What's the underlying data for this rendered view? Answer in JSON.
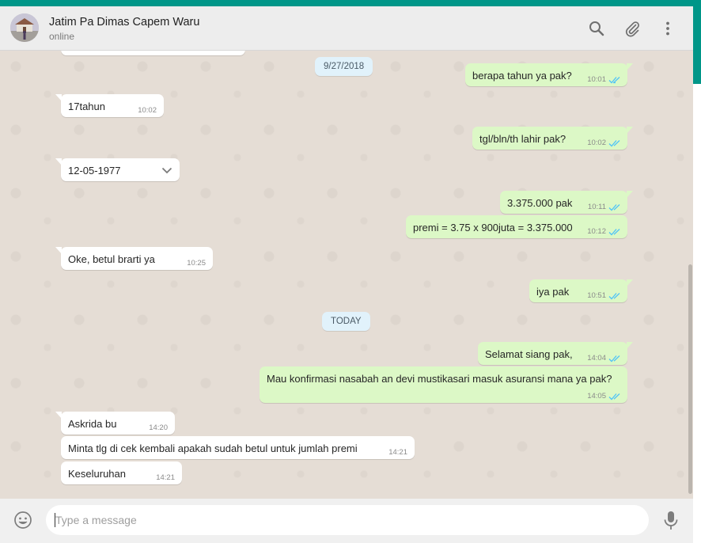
{
  "header": {
    "contact_name": "Jatim Pa Dimas Capem Waru",
    "status": "online",
    "icons": [
      "search-icon",
      "paperclip-icon",
      "menu-dots-icon"
    ]
  },
  "dates": {
    "first": "9/27/2018",
    "today": "TODAY"
  },
  "messages": [
    {
      "dir": "out",
      "text": "berapa tahun ya pak?",
      "time": "10:01"
    },
    {
      "dir": "in",
      "text": "17tahun",
      "time": "10:02"
    },
    {
      "dir": "out",
      "text": "tgl/bln/th lahir pak?",
      "time": "10:02"
    },
    {
      "dir": "in",
      "text": "12-05-1977",
      "time": ""
    },
    {
      "dir": "out",
      "text": "3.375.000 pak",
      "time": "10:11"
    },
    {
      "dir": "out",
      "text": "premi = 3.75 x 900juta = 3.375.000",
      "time": "10:12"
    },
    {
      "dir": "in",
      "text": "Oke, betul brarti ya",
      "time": "10:25"
    },
    {
      "dir": "out",
      "text": "iya pak",
      "time": "10:51"
    },
    {
      "dir": "out",
      "text": "Selamat siang pak,",
      "time": "14:04"
    },
    {
      "dir": "out",
      "text": "Mau konfirmasi nasabah an devi mustikasari masuk asuransi mana ya pak?",
      "time": "14:05"
    },
    {
      "dir": "in",
      "text": "Askrida bu",
      "time": "14:20"
    },
    {
      "dir": "in",
      "text": "Minta tlg di cek kembali apakah sudah betul untuk jumlah premi",
      "time": "14:21"
    },
    {
      "dir": "in",
      "text": "Keseluruhan",
      "time": "14:21"
    }
  ],
  "composer": {
    "placeholder": "Type a message",
    "icons": [
      "emoji-icon",
      "microphone-icon"
    ]
  },
  "colors": {
    "accent": "#009688",
    "outgoing_bubble": "#dcf8c6",
    "incoming_bubble": "#ffffff",
    "chat_background": "#e5ddd5",
    "read_ticks": "#4fc3f7"
  }
}
